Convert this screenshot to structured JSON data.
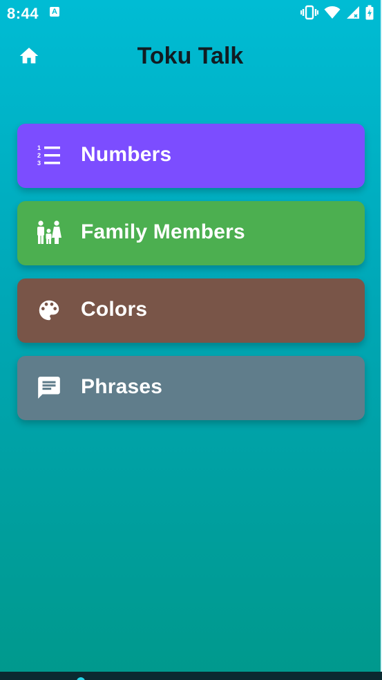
{
  "status_bar": {
    "time": "8:44",
    "notification_letter": "A"
  },
  "app_bar": {
    "title": "Toku Talk",
    "home_icon": "home-icon"
  },
  "menu": {
    "items": [
      {
        "label": "Numbers",
        "icon": "numbered-list-icon",
        "color": "#7c4dff"
      },
      {
        "label": "Family Members",
        "icon": "family-icon",
        "color": "#4caf50"
      },
      {
        "label": "Colors",
        "icon": "palette-icon",
        "color": "#795548"
      },
      {
        "label": "Phrases",
        "icon": "chat-message-icon",
        "color": "#607d8b"
      }
    ]
  },
  "colors": {
    "background_top": "#00bcd4",
    "background_bottom": "#00998d",
    "title_text": "#111c22"
  }
}
